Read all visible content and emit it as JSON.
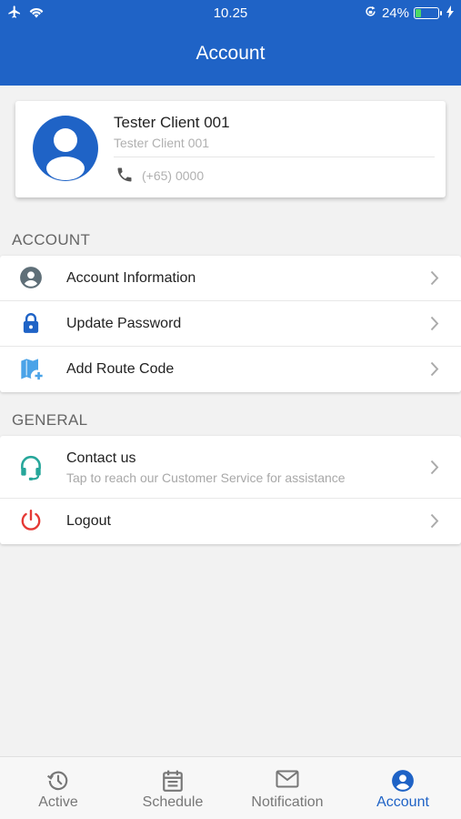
{
  "status_bar": {
    "time": "10.25",
    "battery_text": "24%",
    "battery_level": 0.24,
    "battery_color": "#4cd964"
  },
  "header": {
    "title": "Account",
    "background": "#1f63c6"
  },
  "profile": {
    "name": "Tester Client 001",
    "subtitle": "Tester Client 001",
    "phone": "(+65) 0000",
    "avatar_icon": "user-avatar-icon"
  },
  "sections": {
    "account_label": "ACCOUNT",
    "general_label": "GENERAL"
  },
  "account_items": [
    {
      "label": "Account Information",
      "icon": "user-circle-icon",
      "icon_color": "#5f6f78"
    },
    {
      "label": "Update Password",
      "icon": "lock-icon",
      "icon_color": "#1f63c6"
    },
    {
      "label": "Add Route Code",
      "icon": "map-add-icon",
      "icon_color": "#4aa3e8"
    }
  ],
  "general_items": [
    {
      "label": "Contact us",
      "subtitle": "Tap to reach our Customer Service for assistance",
      "icon": "headset-icon",
      "icon_color": "#26a69a"
    },
    {
      "label": "Logout",
      "icon": "power-icon",
      "icon_color": "#e53935"
    }
  ],
  "tabs": [
    {
      "label": "Active",
      "icon": "clock-history-icon",
      "active": false
    },
    {
      "label": "Schedule",
      "icon": "calendar-icon",
      "active": false
    },
    {
      "label": "Notification",
      "icon": "mail-icon",
      "active": false
    },
    {
      "label": "Account",
      "icon": "user-circle-icon",
      "active": true
    }
  ],
  "colors": {
    "accent": "#1f63c6",
    "inactive_tab": "#777777"
  }
}
